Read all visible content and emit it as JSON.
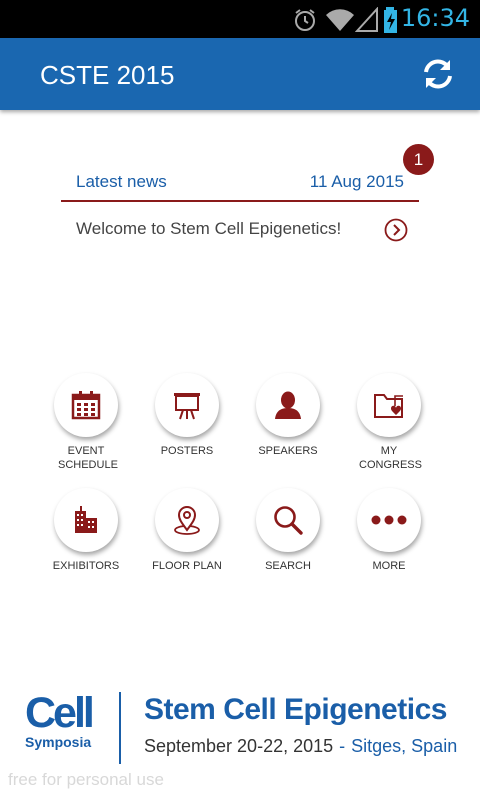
{
  "status_bar": {
    "time": "16:34",
    "icons": [
      "alarm-icon",
      "wifi-icon",
      "signal-icon",
      "battery-charging-icon"
    ]
  },
  "app_bar": {
    "title": "CSTE 2015",
    "action_icon": "refresh-icon"
  },
  "news": {
    "label": "Latest news",
    "date": "11 Aug 2015",
    "badge_count": "1",
    "items": [
      {
        "text": "Welcome to Stem Cell Epigenetics!",
        "icon": "chevron-right-circle-icon"
      }
    ]
  },
  "menu": [
    {
      "label": "EVENT SCHEDULE",
      "icon": "calendar-icon"
    },
    {
      "label": "POSTERS",
      "icon": "easel-icon"
    },
    {
      "label": "SPEAKERS",
      "icon": "person-icon"
    },
    {
      "label": "MY CONGRESS",
      "icon": "folder-heart-icon"
    },
    {
      "label": "EXHIBITORS",
      "icon": "buildings-icon"
    },
    {
      "label": "FLOOR PLAN",
      "icon": "map-pin-icon"
    },
    {
      "label": "SEARCH",
      "icon": "search-icon"
    },
    {
      "label": "MORE",
      "icon": "more-dots-icon"
    }
  ],
  "footer": {
    "logo_word": "Cell",
    "logo_sub": "Symposia",
    "title": "Stem Cell Epigenetics",
    "dates": "September 20-22, 2015",
    "separator": "-",
    "location": "Sitges, Spain"
  },
  "watermark": "free for personal use",
  "colors": {
    "app_bar": "#1a67b0",
    "accent_red": "#8a1a1a",
    "link_blue": "#1a5ea8",
    "status_blue": "#33b5e5"
  }
}
